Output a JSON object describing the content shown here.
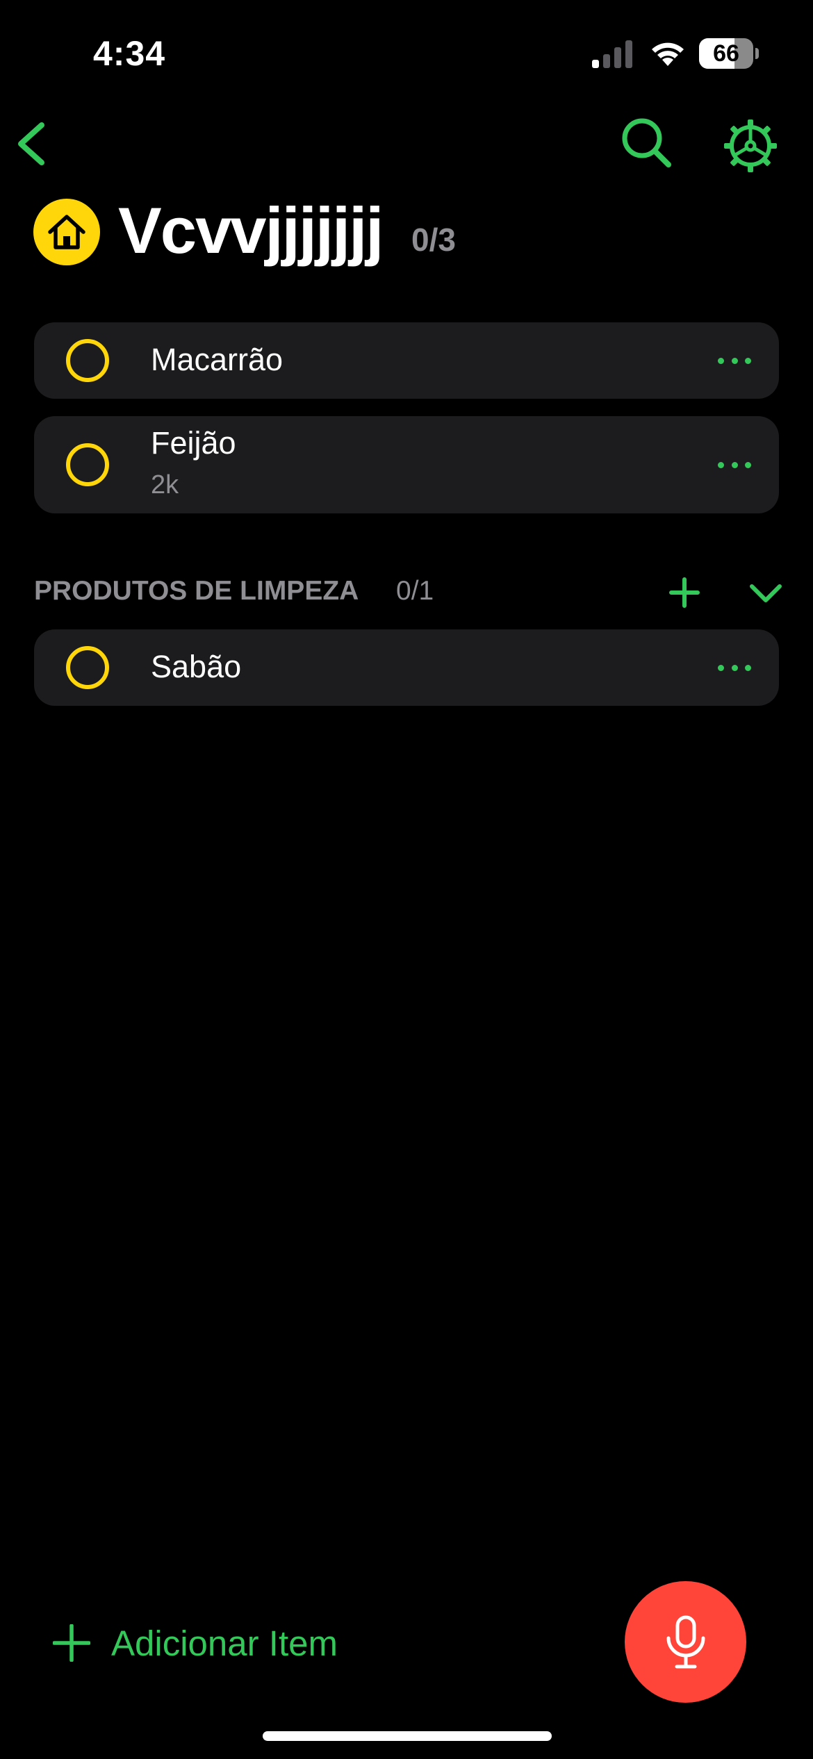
{
  "status_bar": {
    "time": "4:34",
    "battery_level": "66",
    "battery_fraction": 0.66
  },
  "nav": {
    "back_icon": "chevron-left-icon",
    "search_icon": "search-icon",
    "settings_icon": "gear-icon"
  },
  "list": {
    "icon": "house-icon",
    "title": "Vcvvjjjjjjj",
    "count": "0/3"
  },
  "items": [
    {
      "name": "Macarrão",
      "note": ""
    },
    {
      "name": "Feijão",
      "note": "2k"
    }
  ],
  "sections": [
    {
      "title": "PRODUTOS DE LIMPEZA",
      "count": "0/1",
      "items": [
        {
          "name": "Sabão"
        }
      ]
    }
  ],
  "bottom": {
    "add_item_label": "Adicionar Item",
    "mic_icon": "microphone-icon"
  },
  "colors": {
    "accent": "#34c759",
    "checkbox": "#ffd60a",
    "icon_badge": "#ffd60a",
    "mic_button": "#ff453a",
    "card": "#1c1c1e",
    "secondary_text": "#8e8e93"
  }
}
